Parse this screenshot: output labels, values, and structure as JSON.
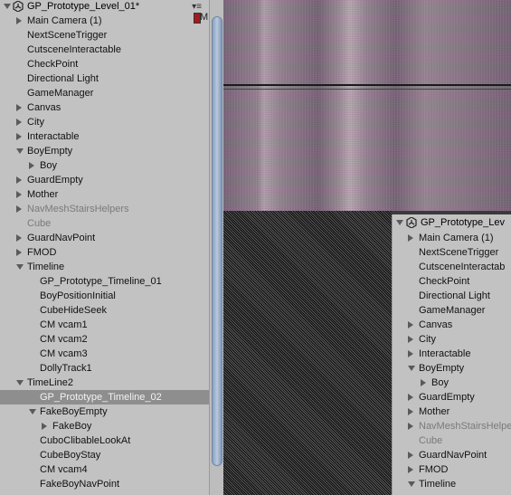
{
  "left_panel": {
    "scene_title": "GP_Prototype_Level_01*",
    "menu_glyph": "▾≡",
    "mark_letter": "M",
    "items": [
      {
        "label": "Main Camera (1)",
        "depth": 1,
        "arrow": "right"
      },
      {
        "label": "NextSceneTrigger",
        "depth": 1,
        "arrow": ""
      },
      {
        "label": "CutsceneInteractable",
        "depth": 1,
        "arrow": ""
      },
      {
        "label": "CheckPoint",
        "depth": 1,
        "arrow": ""
      },
      {
        "label": "Directional Light",
        "depth": 1,
        "arrow": ""
      },
      {
        "label": "GameManager",
        "depth": 1,
        "arrow": ""
      },
      {
        "label": "Canvas",
        "depth": 1,
        "arrow": "right"
      },
      {
        "label": "City",
        "depth": 1,
        "arrow": "right"
      },
      {
        "label": "Interactable",
        "depth": 1,
        "arrow": "right"
      },
      {
        "label": "BoyEmpty",
        "depth": 1,
        "arrow": "down"
      },
      {
        "label": "Boy",
        "depth": 2,
        "arrow": "right"
      },
      {
        "label": "GuardEmpty",
        "depth": 1,
        "arrow": "right"
      },
      {
        "label": "Mother",
        "depth": 1,
        "arrow": "right"
      },
      {
        "label": "NavMeshStairsHelpers",
        "depth": 1,
        "arrow": "right",
        "dim": true
      },
      {
        "label": "Cube",
        "depth": 1,
        "arrow": "",
        "dim": true
      },
      {
        "label": "GuardNavPoint",
        "depth": 1,
        "arrow": "right"
      },
      {
        "label": "FMOD",
        "depth": 1,
        "arrow": "right"
      },
      {
        "label": "Timeline",
        "depth": 1,
        "arrow": "down"
      },
      {
        "label": "GP_Prototype_Timeline_01",
        "depth": 2,
        "arrow": ""
      },
      {
        "label": "BoyPositionInitial",
        "depth": 2,
        "arrow": ""
      },
      {
        "label": "CubeHideSeek",
        "depth": 2,
        "arrow": ""
      },
      {
        "label": "CM vcam1",
        "depth": 2,
        "arrow": ""
      },
      {
        "label": "CM vcam2",
        "depth": 2,
        "arrow": ""
      },
      {
        "label": "CM vcam3",
        "depth": 2,
        "arrow": ""
      },
      {
        "label": "DollyTrack1",
        "depth": 2,
        "arrow": ""
      },
      {
        "label": "TimeLine2",
        "depth": 1,
        "arrow": "down"
      },
      {
        "label": "GP_Prototype_Timeline_02",
        "depth": 2,
        "arrow": "",
        "selected": true
      },
      {
        "label": "FakeBoyEmpty",
        "depth": 2,
        "arrow": "down"
      },
      {
        "label": "FakeBoy",
        "depth": 3,
        "arrow": "right"
      },
      {
        "label": "CuboClibableLookAt",
        "depth": 2,
        "arrow": ""
      },
      {
        "label": "CubeBoyStay",
        "depth": 2,
        "arrow": ""
      },
      {
        "label": "CM vcam4",
        "depth": 2,
        "arrow": ""
      },
      {
        "label": "FakeBoyNavPoint",
        "depth": 2,
        "arrow": ""
      }
    ]
  },
  "right_panel": {
    "scene_title": "GP_Prototype_Lev",
    "items": [
      {
        "label": "Main Camera (1)",
        "depth": 1,
        "arrow": "right"
      },
      {
        "label": "NextSceneTrigger",
        "depth": 1,
        "arrow": ""
      },
      {
        "label": "CutsceneInteractab",
        "depth": 1,
        "arrow": ""
      },
      {
        "label": "CheckPoint",
        "depth": 1,
        "arrow": ""
      },
      {
        "label": "Directional Light",
        "depth": 1,
        "arrow": ""
      },
      {
        "label": "GameManager",
        "depth": 1,
        "arrow": ""
      },
      {
        "label": "Canvas",
        "depth": 1,
        "arrow": "right"
      },
      {
        "label": "City",
        "depth": 1,
        "arrow": "right"
      },
      {
        "label": "Interactable",
        "depth": 1,
        "arrow": "right"
      },
      {
        "label": "BoyEmpty",
        "depth": 1,
        "arrow": "down"
      },
      {
        "label": "Boy",
        "depth": 2,
        "arrow": "right"
      },
      {
        "label": "GuardEmpty",
        "depth": 1,
        "arrow": "right"
      },
      {
        "label": "Mother",
        "depth": 1,
        "arrow": "right"
      },
      {
        "label": "NavMeshStairsHelpe",
        "depth": 1,
        "arrow": "right",
        "dim": true
      },
      {
        "label": "Cube",
        "depth": 1,
        "arrow": "",
        "dim": true
      },
      {
        "label": "GuardNavPoint",
        "depth": 1,
        "arrow": "right"
      },
      {
        "label": "FMOD",
        "depth": 1,
        "arrow": "right"
      },
      {
        "label": "Timeline",
        "depth": 1,
        "arrow": "down"
      }
    ]
  },
  "colors": {
    "panel_bg": "#c2c2c2",
    "selected_bg": "#8e8e8e",
    "dim_text": "#7a7a7a"
  },
  "icons": {
    "scene": "unity-scene-icon",
    "expand": "triangle-right-icon",
    "collapse": "triangle-down-icon"
  }
}
